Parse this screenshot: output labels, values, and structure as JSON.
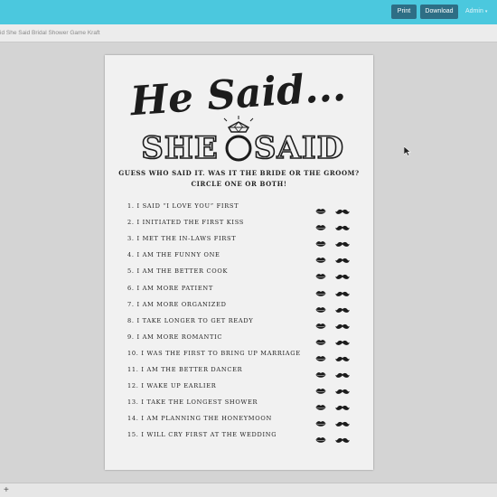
{
  "toolbar": {
    "print_label": "Print",
    "download_label": "Download",
    "admin_label": "Admin"
  },
  "document": {
    "title": "id She Said Bridal Shower Game Kraft"
  },
  "card": {
    "title_line1": "He Said...",
    "title_line2_left": "SHE",
    "title_line2_right": "SAID",
    "instructions_line1": "GUESS WHO SAID IT. WAS IT THE BRIDE OR THE GROOM?",
    "instructions_line2": "CIRCLE ONE OR BOTH!",
    "questions": [
      "1. I SAID “I LOVE YOU” FIRST",
      "2. I INITIATED THE FIRST KISS",
      "3. I MET THE IN-LAWS FIRST",
      "4. I AM THE FUNNY ONE",
      "5. I AM THE BETTER COOK",
      "6. I AM MORE PATIENT",
      "7. I AM MORE ORGANIZED",
      "8. I TAKE LONGER TO GET READY",
      "9. I AM MORE ROMANTIC",
      "10. I WAS THE FIRST TO BRING UP MARRIAGE",
      "11. I AM THE BETTER DANCER",
      "12. I WAKE UP EARLIER",
      "13. I TAKE THE LONGEST SHOWER",
      "14. I AM PLANNING THE HONEYMOON",
      "15. I WILL CRY FIRST AT THE WEDDING"
    ]
  },
  "icons": {
    "ring": "ring-icon",
    "bride": "lips-icon",
    "groom": "mustache-icon"
  },
  "colors": {
    "topbar": "#4bc8de",
    "button": "#2e6e85",
    "ink": "#1c1c1c",
    "paper": "#f1f1f1"
  }
}
